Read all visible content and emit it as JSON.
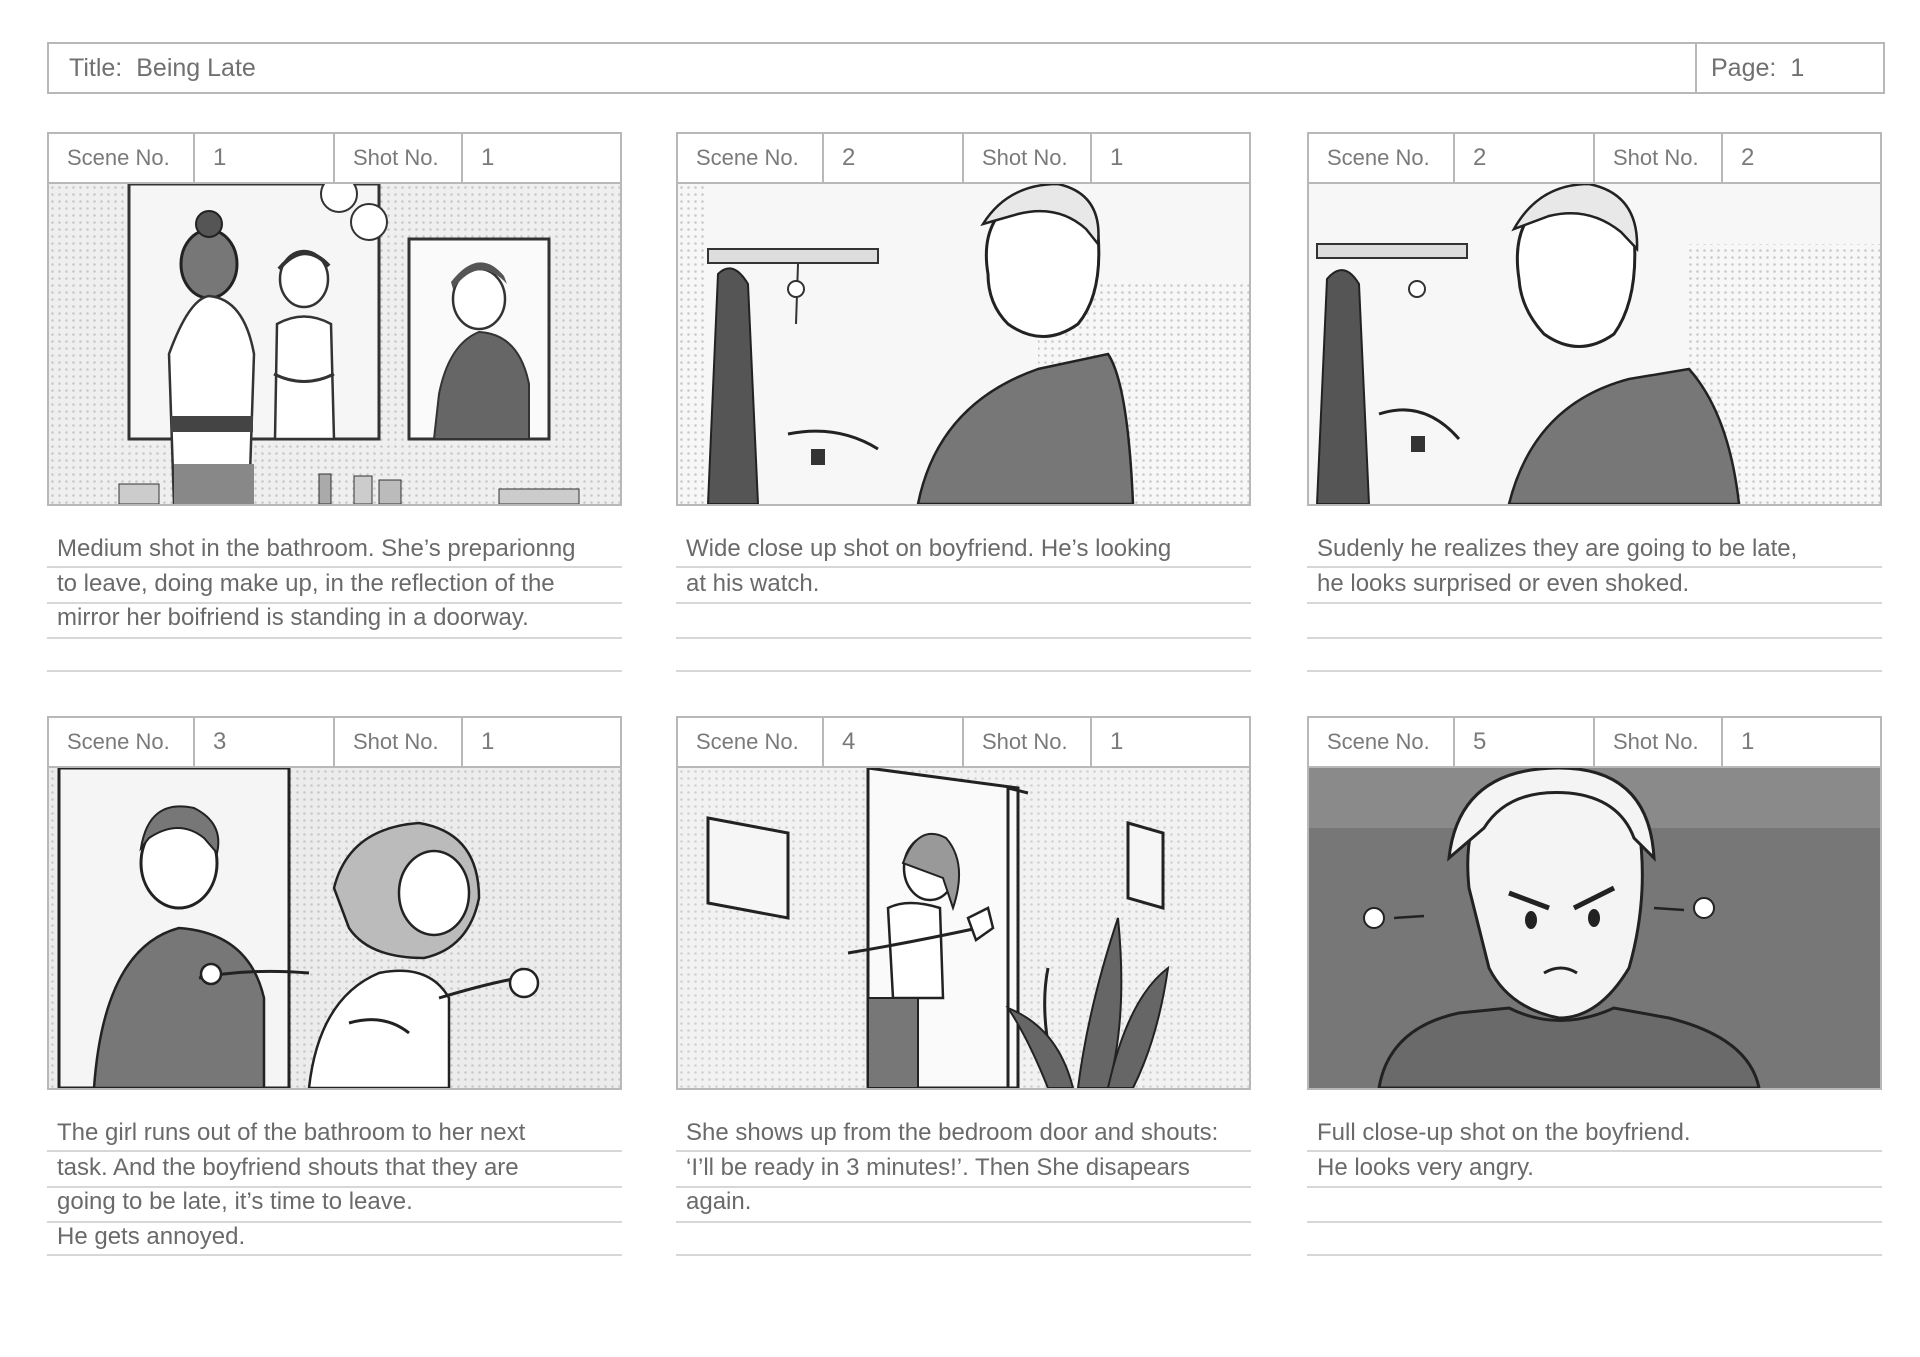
{
  "header": {
    "title_label": "Title:",
    "title_value": "Being Late",
    "page_label": "Page:",
    "page_value": "1"
  },
  "panels": [
    {
      "scene_label": "Scene No.",
      "scene": "1",
      "shot_label": "Shot No.",
      "shot": "1",
      "description": "Medium shot in the bathroom. She’s preparionng\nto leave, doing make up, in the reflection of the\nmirror her boifriend is standing in a doorway."
    },
    {
      "scene_label": "Scene No.",
      "scene": "2",
      "shot_label": "Shot No.",
      "shot": "1",
      "description": "Wide close up shot on boyfriend. He’s looking\nat his watch."
    },
    {
      "scene_label": "Scene No.",
      "scene": "2",
      "shot_label": "Shot No.",
      "shot": "2",
      "description": "Sudenly he realizes they are going to be late,\nhe looks surprised or even shoked."
    },
    {
      "scene_label": "Scene No.",
      "scene": "3",
      "shot_label": "Shot No.",
      "shot": "1",
      "description": "The girl runs out of the bathroom to her next\ntask. And the boyfriend shouts that they are\ngoing to be late, it’s time to leave.\nHe gets annoyed."
    },
    {
      "scene_label": "Scene No.",
      "scene": "4",
      "shot_label": "Shot No.",
      "shot": "1",
      "description": "She shows up from the bedroom door and shouts:\n‘I’ll be ready in 3 minutes!’. Then She disapears\nagain."
    },
    {
      "scene_label": "Scene No.",
      "scene": "5",
      "shot_label": "Shot No.",
      "shot": "1",
      "description": "Full close-up shot on the boyfriend.\nHe looks very angry."
    }
  ]
}
